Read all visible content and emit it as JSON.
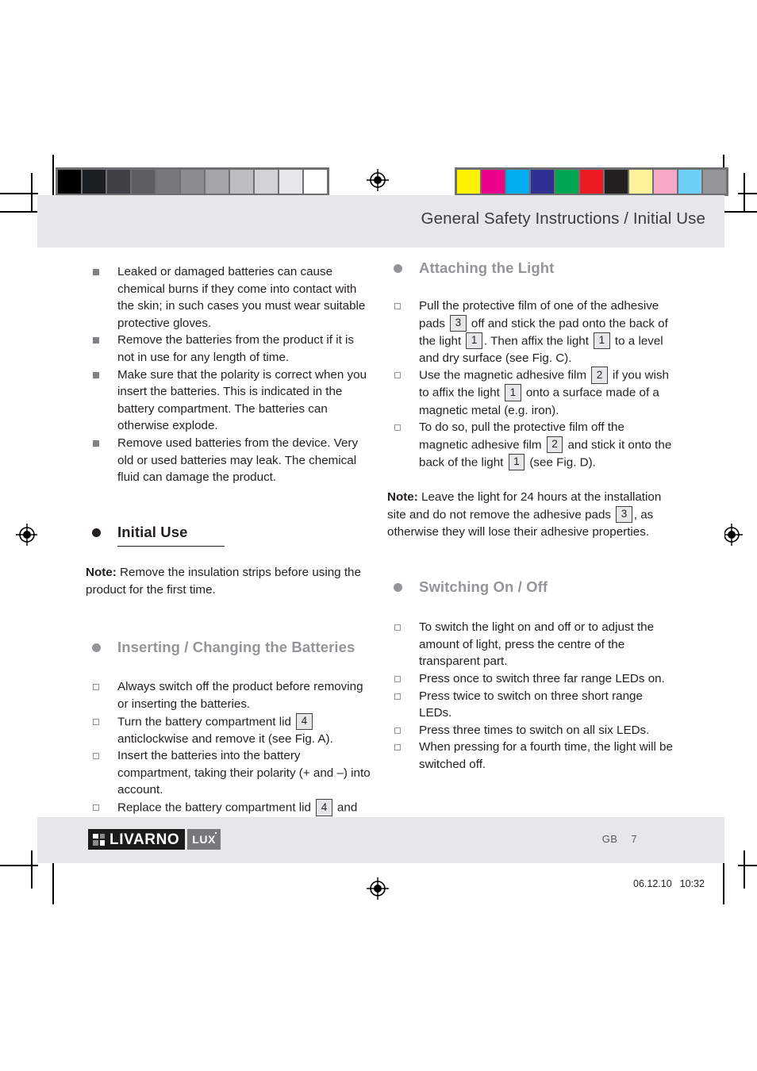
{
  "header": {
    "title": "General Safety Instructions / Initial Use"
  },
  "footer": {
    "logo_main": "LIVARNO",
    "logo_sub": "LUX",
    "country_code": "GB",
    "page_number": "7"
  },
  "print_marks": {
    "timestamp_date": "06.12.10",
    "timestamp_time": "10:32",
    "grayscale_steps": [
      "#000000",
      "#1b1f22",
      "#3e4246",
      "#5a5e61",
      "#75797c",
      "#8b8e91",
      "#a3a5a8",
      "#bcbec0",
      "#d1d3d4",
      "#e6e7e8",
      "#ffffff"
    ],
    "color_steps": [
      "#fff200",
      "#ec008c",
      "#00aeef",
      "#2e3192",
      "#00a651",
      "#ed1c24",
      "#231f20",
      "#fbf29a",
      "#f7a8c4",
      "#6dcff6",
      "#939598"
    ]
  },
  "left_column": {
    "safety_bullets": [
      "Leaked or damaged batteries can cause chemical burns if they come into contact with the skin; in such cases you must wear suitable protective gloves.",
      "Remove the batteries from the product if it is not in use for any length of time.",
      "Make sure that the polarity is correct when you insert the batteries. This is indicated in the battery compartment. The batteries can otherwise explode.",
      "Remove used batteries from the device. Very old or used batteries may leak. The chemical fluid can damage the product."
    ],
    "initial_use_heading": "Initial Use",
    "initial_use_note_label": "Note:",
    "initial_use_note_text": " Remove the insulation strips before using the product for the first time.",
    "batteries_heading": "Inserting / Changing the Batteries",
    "battery_steps": [
      {
        "pre": "Always switch off the product before removing or inserting the batteries.",
        "ref": null,
        "post": ""
      },
      {
        "pre": "Turn the battery compartment lid ",
        "ref": "4",
        "post": " anticlockwise and remove it (see Fig. A)."
      },
      {
        "pre": "Insert the batteries into the battery compartment, taking their polarity (+ and –) into account.",
        "ref": null,
        "post": ""
      },
      {
        "pre": "Replace the battery compartment lid ",
        "ref": "4",
        "post": " and tighten it by turning it clockwise (see Fig. B)."
      }
    ]
  },
  "right_column": {
    "attaching_heading": "Attaching the Light",
    "attaching_steps": [
      {
        "p1": "Pull the protective film of one of the adhesive pads ",
        "r1": "3",
        "p2": " off and stick the pad onto the back of the light ",
        "r2": "1",
        "p3": ". Then affix the light ",
        "r3": "1",
        "p4": " to a level and dry surface (see Fig. C)."
      },
      {
        "p1": "Use the magnetic adhesive film ",
        "r1": "2",
        "p2": " if you wish to affix the light ",
        "r2": "1",
        "p3": " onto a surface made of a magnetic metal (e.g. iron).",
        "r3": null,
        "p4": ""
      },
      {
        "p1": "To do so, pull the protective film off the magnetic adhesive film ",
        "r1": "2",
        "p2": " and stick it onto the back of the light ",
        "r2": "1",
        "p3": " (see Fig. D).",
        "r3": null,
        "p4": ""
      }
    ],
    "attaching_note_label": "Note:",
    "attaching_note_pre": " Leave the light for 24 hours at the installation site and do not remove the adhesive pads ",
    "attaching_note_ref": "3",
    "attaching_note_post": ", as otherwise they will lose their adhesive properties.",
    "switching_heading": "Switching On / Off",
    "switching_steps": [
      "To switch the light on and off or to adjust the amount of light, press the centre of the transparent part.",
      "Press once to switch three far range LEDs on.",
      "Press twice to switch on three short range LEDs.",
      "Press three times to switch on all six LEDs.",
      "When pressing for a fourth time, the light will be switched off."
    ]
  }
}
